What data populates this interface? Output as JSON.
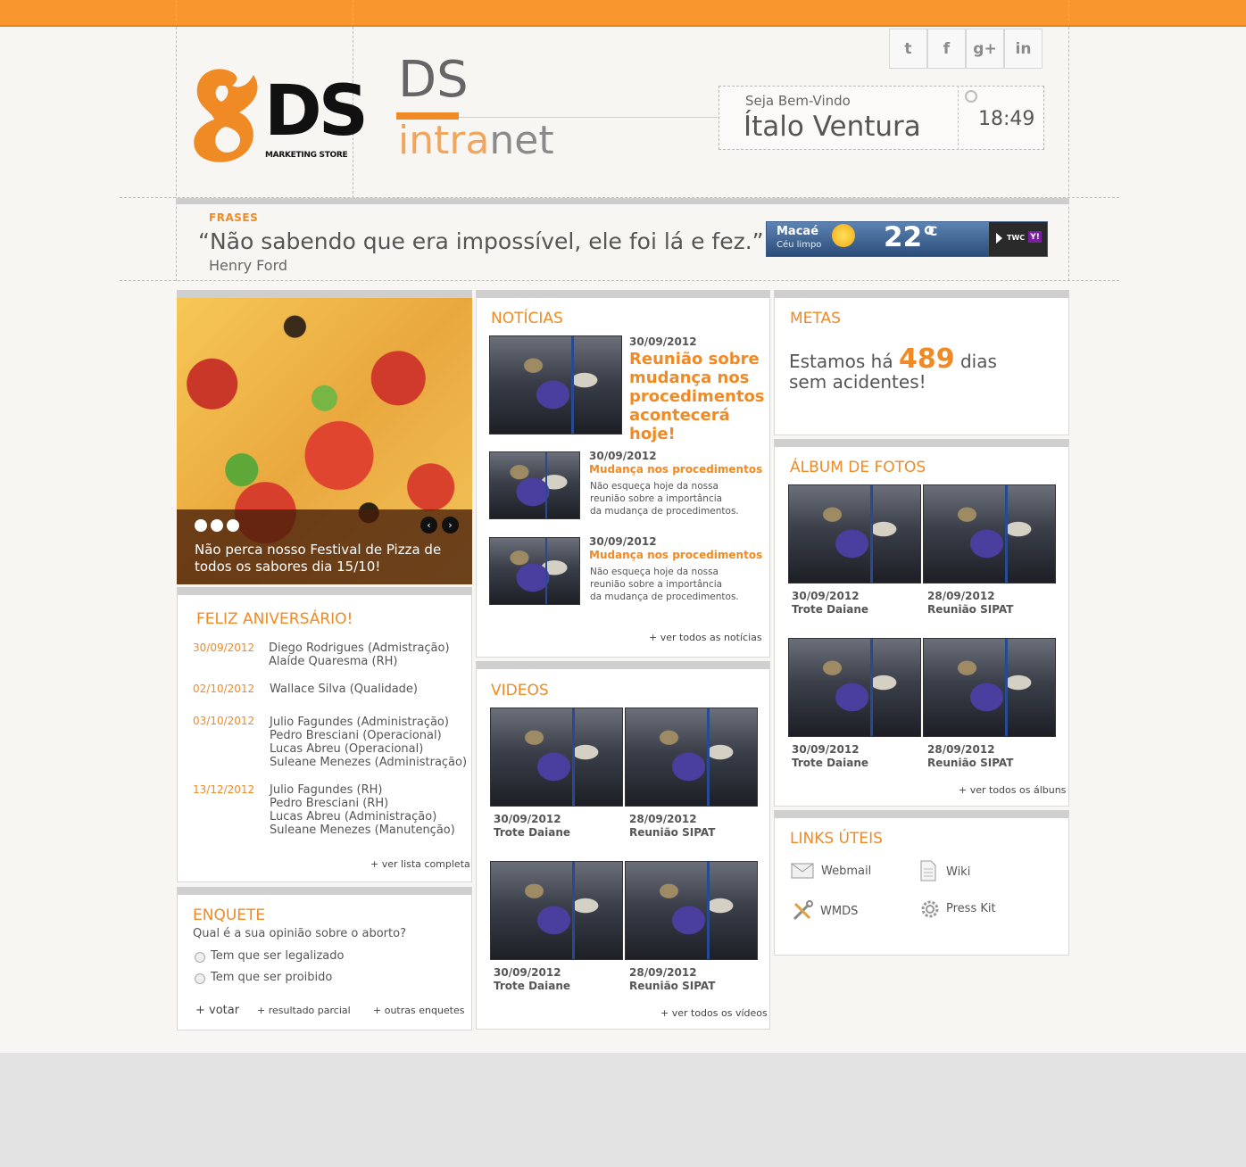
{
  "brand": {
    "logo_letters": "DS",
    "logo_sub": "MARKETING STORE",
    "title_ds": "DS",
    "title_intra": "intra",
    "title_net": "net"
  },
  "social": [
    {
      "icon": "twitter-icon",
      "glyph": "t"
    },
    {
      "icon": "facebook-icon",
      "glyph": "f"
    },
    {
      "icon": "googleplus-icon",
      "glyph": "g+"
    },
    {
      "icon": "linkedin-icon",
      "glyph": "in"
    }
  ],
  "welcome": {
    "label": "Seja Bem-Vindo",
    "name": "Ítalo Ventura",
    "time": "18:49"
  },
  "quote": {
    "label": "FRASES",
    "text": "“Não sabendo que era impossível, ele foi lá e fez.”",
    "author": "Henry Ford"
  },
  "weather": {
    "city": "Macaé",
    "condition": "Céu limpo",
    "temp": "22°",
    "unit": "C",
    "provider": "TWC",
    "yahoo": "Y!"
  },
  "slider": {
    "caption": "Não perca nosso Festival de Pizza de todos os sabores dia 15/10!",
    "prev": "‹",
    "next": "›"
  },
  "birthdays": {
    "title": "FELIZ ANIVERSÁRIO!",
    "entries": [
      {
        "date": "30/09/2012",
        "names": [
          "Diego Rodrigues (Admistração)",
          "Alaíde Quaresma (RH)"
        ]
      },
      {
        "date": "02/10/2012",
        "names": [
          "Wallace Silva (Qualidade)"
        ]
      },
      {
        "date": "03/10/2012",
        "names": [
          "Julio Fagundes (Administração)",
          "Pedro Bresciani (Operacional)",
          "Lucas Abreu (Operacional)",
          "Suleane Menezes (Administração)"
        ]
      },
      {
        "date": "13/12/2012",
        "names": [
          "Julio Fagundes (RH)",
          "Pedro Bresciani (RH)",
          "Lucas Abreu (Administração)",
          "Suleane Menezes (Manutenção)"
        ]
      }
    ],
    "more": "+ ver lista completa"
  },
  "poll": {
    "title": "ENQUETE",
    "question": "Qual é a sua opinião sobre o aborto?",
    "options": [
      "Tem que ser legalizado",
      "Tem que ser proibido"
    ],
    "vote": "+ votar",
    "partial": "+ resultado parcial",
    "others": "+ outras enquetes"
  },
  "news": {
    "title": "NOTÍCIAS",
    "featured": {
      "date": "30/09/2012",
      "headline": "Reunião sobre mudança nos procedimentos acontecerá hoje!"
    },
    "items": [
      {
        "date": "30/09/2012",
        "headline": "Mudança nos procedimentos",
        "body": [
          "Não esqueça hoje da nossa",
          "reunião sobre a importância",
          "da mudança de procedimentos."
        ]
      },
      {
        "date": "30/09/2012",
        "headline": "Mudança nos procedimentos",
        "body": [
          "Não esqueça hoje da nossa",
          "reunião sobre a importância",
          "da mudança de procedimentos."
        ]
      }
    ],
    "more": "+ ver todos as notícias"
  },
  "videos": {
    "title": "VIDEOS",
    "items": [
      {
        "date": "30/09/2012",
        "title": "Trote Daiane"
      },
      {
        "date": "28/09/2012",
        "title": "Reunião SIPAT"
      },
      {
        "date": "30/09/2012",
        "title": "Trote Daiane"
      },
      {
        "date": "28/09/2012",
        "title": "Reunião SIPAT"
      }
    ],
    "more": "+ ver todos os vídeos"
  },
  "goals": {
    "title": "METAS",
    "prefix": "Estamos há",
    "days": "489",
    "suffix": "dias",
    "line2": "sem acidentes!"
  },
  "album": {
    "title": "ÁLBUM DE FOTOS",
    "items": [
      {
        "date": "30/09/2012",
        "title": "Trote Daiane"
      },
      {
        "date": "28/09/2012",
        "title": "Reunião SIPAT"
      },
      {
        "date": "30/09/2012",
        "title": "Trote Daiane"
      },
      {
        "date": "28/09/2012",
        "title": "Reunião SIPAT"
      }
    ],
    "more": "+ ver todos os álbuns"
  },
  "links": {
    "title": "LINKS ÚTEIS",
    "items": [
      {
        "label": "Webmail",
        "icon": "mail-icon"
      },
      {
        "label": "Wiki",
        "icon": "document-icon"
      },
      {
        "label": "WMDS",
        "icon": "tools-icon"
      },
      {
        "label": "Press Kit",
        "icon": "gear-icon"
      }
    ]
  },
  "colors": {
    "accent": "#f08a24",
    "topbar": "#f9962d",
    "text": "#555555"
  }
}
